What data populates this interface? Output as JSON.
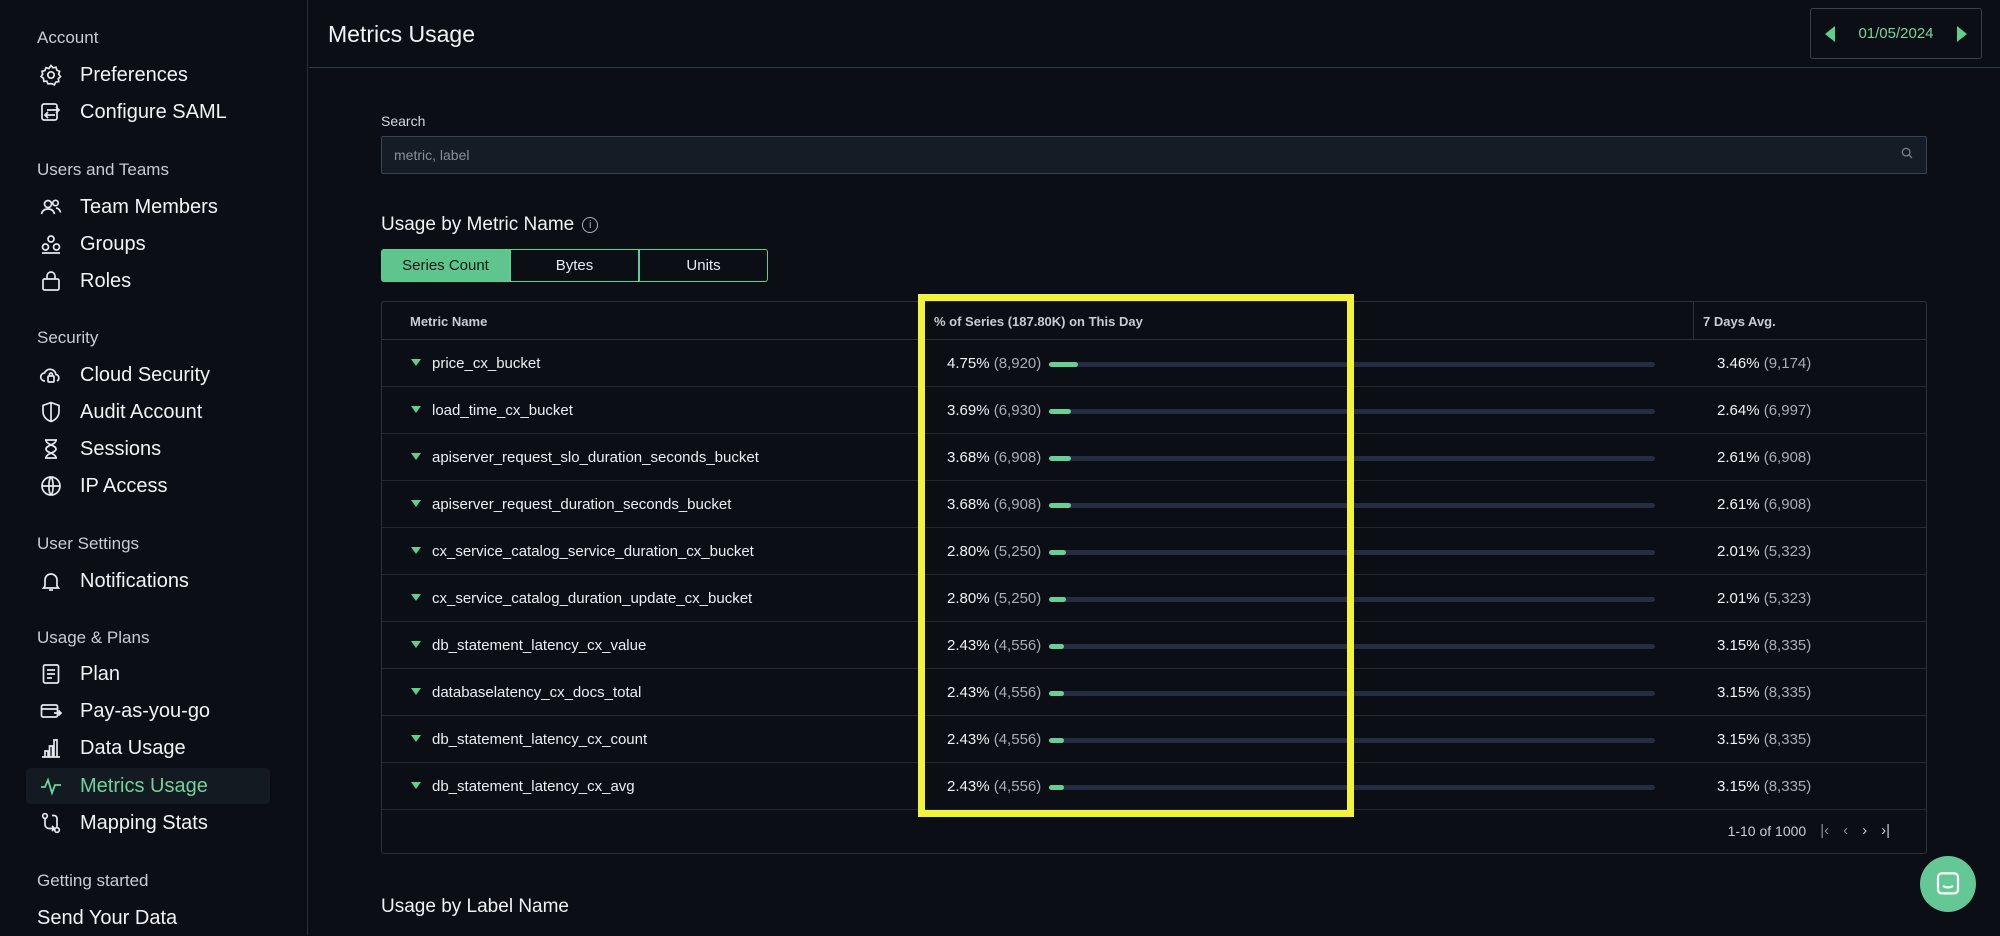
{
  "sidebar": {
    "sections": [
      {
        "title": "Account",
        "items": [
          {
            "label": "Preferences",
            "icon": "gear-icon"
          },
          {
            "label": "Configure SAML",
            "icon": "swap-icon"
          }
        ]
      },
      {
        "title": "Users and Teams",
        "items": [
          {
            "label": "Team Members",
            "icon": "users-icon"
          },
          {
            "label": "Groups",
            "icon": "groups-icon"
          },
          {
            "label": "Roles",
            "icon": "lock-icon"
          }
        ]
      },
      {
        "title": "Security",
        "items": [
          {
            "label": "Cloud Security",
            "icon": "cloud-lock-icon"
          },
          {
            "label": "Audit Account",
            "icon": "shield-icon"
          },
          {
            "label": "Sessions",
            "icon": "hourglass-icon"
          },
          {
            "label": "IP Access",
            "icon": "globe-icon"
          }
        ]
      },
      {
        "title": "User Settings",
        "items": [
          {
            "label": "Notifications",
            "icon": "bell-icon"
          }
        ]
      },
      {
        "title": "Usage & Plans",
        "items": [
          {
            "label": "Plan",
            "icon": "document-icon"
          },
          {
            "label": "Pay-as-you-go",
            "icon": "card-icon"
          },
          {
            "label": "Data Usage",
            "icon": "bar-chart-icon"
          },
          {
            "label": "Metrics Usage",
            "icon": "pulse-icon",
            "active": true
          },
          {
            "label": "Mapping Stats",
            "icon": "mapping-icon"
          }
        ]
      },
      {
        "title": "Getting started",
        "items": [
          {
            "label": "Send Your Data",
            "icon": ""
          }
        ]
      }
    ]
  },
  "header": {
    "title": "Metrics Usage",
    "date": "01/05/2024"
  },
  "search": {
    "label": "Search",
    "placeholder": "metric, label",
    "value": ""
  },
  "usage_by_metric": {
    "title": "Usage by Metric Name",
    "toggles": [
      "Series Count",
      "Bytes",
      "Units"
    ],
    "selected_toggle": "Series Count",
    "columns": {
      "name": "Metric Name",
      "pct": "% of Series (187.80K) on This Day",
      "avg": "7 Days Avg."
    },
    "rows": [
      {
        "name": "price_cx_bucket",
        "pct": "4.75%",
        "count": "(8,920)",
        "pct_value": 4.75,
        "avg": "3.46%",
        "avg_count": "(9,174)"
      },
      {
        "name": "load_time_cx_bucket",
        "pct": "3.69%",
        "count": "(6,930)",
        "pct_value": 3.69,
        "avg": "2.64%",
        "avg_count": "(6,997)"
      },
      {
        "name": "apiserver_request_slo_duration_seconds_bucket",
        "pct": "3.68%",
        "count": "(6,908)",
        "pct_value": 3.68,
        "avg": "2.61%",
        "avg_count": "(6,908)"
      },
      {
        "name": "apiserver_request_duration_seconds_bucket",
        "pct": "3.68%",
        "count": "(6,908)",
        "pct_value": 3.68,
        "avg": "2.61%",
        "avg_count": "(6,908)"
      },
      {
        "name": "cx_service_catalog_service_duration_cx_bucket",
        "pct": "2.80%",
        "count": "(5,250)",
        "pct_value": 2.8,
        "avg": "2.01%",
        "avg_count": "(5,323)"
      },
      {
        "name": "cx_service_catalog_duration_update_cx_bucket",
        "pct": "2.80%",
        "count": "(5,250)",
        "pct_value": 2.8,
        "avg": "2.01%",
        "avg_count": "(5,323)"
      },
      {
        "name": "db_statement_latency_cx_value",
        "pct": "2.43%",
        "count": "(4,556)",
        "pct_value": 2.43,
        "avg": "3.15%",
        "avg_count": "(8,335)"
      },
      {
        "name": "databaselatency_cx_docs_total",
        "pct": "2.43%",
        "count": "(4,556)",
        "pct_value": 2.43,
        "avg": "3.15%",
        "avg_count": "(8,335)"
      },
      {
        "name": "db_statement_latency_cx_count",
        "pct": "2.43%",
        "count": "(4,556)",
        "pct_value": 2.43,
        "avg": "3.15%",
        "avg_count": "(8,335)"
      },
      {
        "name": "db_statement_latency_cx_avg",
        "pct": "2.43%",
        "count": "(4,556)",
        "pct_value": 2.43,
        "avg": "3.15%",
        "avg_count": "(8,335)"
      }
    ],
    "pagination": "1-10 of 1000"
  },
  "usage_by_label": {
    "title": "Usage by Label Name"
  },
  "colors": {
    "accent": "#5fcf8f",
    "highlight": "#f4f33c",
    "background": "#0b0e14"
  }
}
